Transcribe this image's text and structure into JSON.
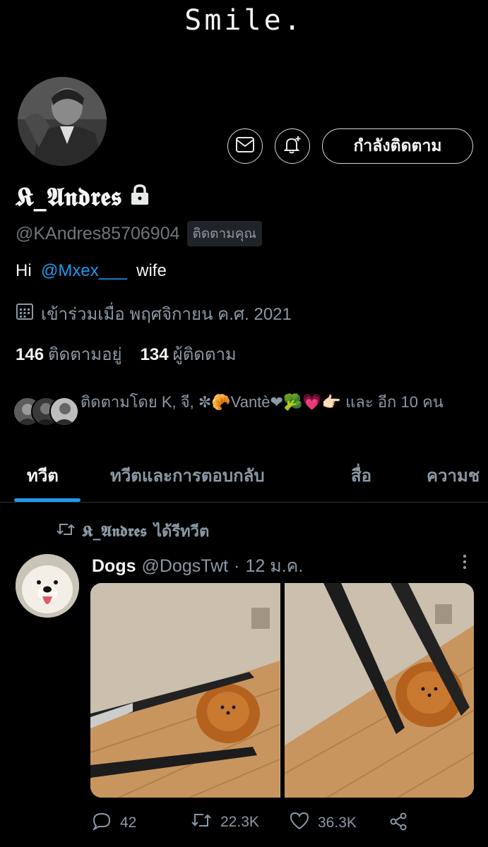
{
  "banner": {
    "text": "Smile."
  },
  "profile": {
    "display_name": "𝕶_𝕬𝖓𝖉𝖗𝖊𝖘",
    "handle": "@KAndres85706904",
    "follows_you": "ติดตามคุณ",
    "bio_prefix": "Hi",
    "bio_mention": "@Mxex___",
    "bio_suffix": "wife",
    "joined": "เข้าร่วมเมื่อ พฤศจิกายน ค.ศ. 2021",
    "following_count": "146",
    "following_label": "ติดตามอยู่",
    "followers_count": "134",
    "followers_label": "ผู้ติดตาม",
    "follow_button": "กำลังติดตาม",
    "followed_by": "ติดตามโดย K, จี, ✼🥐Vantè❤🥦💗👉🏻 และ อีก 10 คน"
  },
  "tabs": [
    {
      "label": "ทวีต",
      "active": true
    },
    {
      "label": "ทวีตและการตอบกลับ",
      "active": false
    },
    {
      "label": "สื่อ",
      "active": false
    },
    {
      "label": "ความช",
      "active": false
    }
  ],
  "retweet": {
    "name": "𝕶_𝕬𝖓𝖉𝖗𝖊𝖘",
    "suffix": "ได้รีทวีต"
  },
  "tweet": {
    "author": "Dogs",
    "handle": "@DogsTwt",
    "separator": "·",
    "date": "12 ม.ค.",
    "replies": "42",
    "retweets": "22.3K",
    "likes": "36.3K"
  },
  "icons": {
    "message": "envelope-icon",
    "bell": "bell-plus-icon",
    "lock": "lock-icon",
    "calendar": "calendar-icon",
    "retweet": "retweet-icon",
    "more": "more-vertical-icon",
    "reply": "reply-icon",
    "like": "heart-icon",
    "share": "share-icon"
  },
  "colors": {
    "background": "#000000",
    "accent": "#1d9bf0",
    "secondary_text": "#8b98a5",
    "primary_text": "#f5f5f5"
  }
}
